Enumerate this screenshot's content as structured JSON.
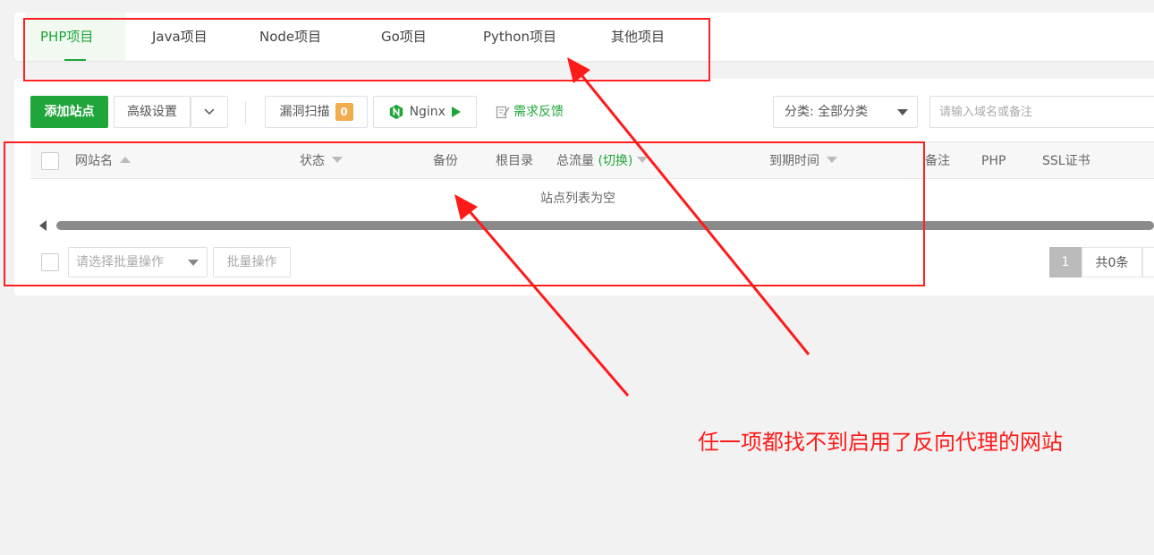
{
  "tabs": [
    {
      "label": "PHP项目",
      "active": true
    },
    {
      "label": "Java项目"
    },
    {
      "label": "Node项目"
    },
    {
      "label": "Go项目"
    },
    {
      "label": "Python项目"
    },
    {
      "label": "其他项目"
    }
  ],
  "toolbar": {
    "add_site": "添加站点",
    "advanced": "高级设置",
    "vuln_scan": "漏洞扫描",
    "vuln_count": "0",
    "nginx": "Nginx",
    "feedback": "需求反馈",
    "category_select": "分类: 全部分类",
    "search_placeholder": "请输入域名或备注"
  },
  "table": {
    "columns": [
      "网站名",
      "状态",
      "备份",
      "根目录",
      "总流量",
      "到期时间",
      "备注",
      "PHP",
      "SSL证书"
    ],
    "traffic_toggle": "(切换)",
    "empty_text": "站点列表为空"
  },
  "footer": {
    "batch_placeholder": "请选择批量操作",
    "batch_button": "批量操作",
    "page_current": "1",
    "total": "共0条"
  },
  "annotation": "任一项都找不到启用了反向代理的网站",
  "colors": {
    "brand": "#20a53a",
    "annotation": "#ff1a1a",
    "badge": "#f0ad4e"
  },
  "icons": {
    "nginx": "nginx-icon",
    "feedback": "edit-icon",
    "play": "play-icon"
  }
}
